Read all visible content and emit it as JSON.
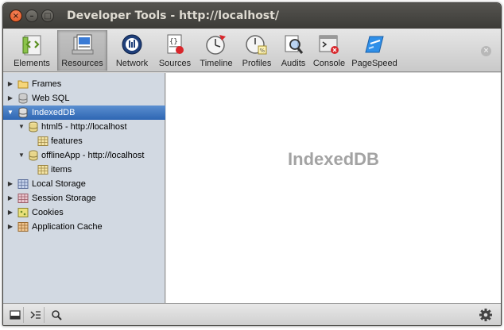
{
  "window": {
    "title": "Developer Tools - http://localhost/",
    "close_glyph": "×",
    "min_glyph": "–",
    "max_glyph": "□"
  },
  "toolbar": {
    "items": [
      {
        "label": "Elements",
        "icon": "elements-icon"
      },
      {
        "label": "Resources",
        "icon": "resources-icon",
        "selected": true
      },
      {
        "label": "Network",
        "icon": "network-icon"
      },
      {
        "label": "Sources",
        "icon": "sources-icon"
      },
      {
        "label": "Timeline",
        "icon": "timeline-icon"
      },
      {
        "label": "Profiles",
        "icon": "profiles-icon"
      },
      {
        "label": "Audits",
        "icon": "audits-icon"
      },
      {
        "label": "Console",
        "icon": "console-icon"
      },
      {
        "label": "PageSpeed",
        "icon": "pagespeed-icon"
      }
    ],
    "close_glyph": "×"
  },
  "sidebar": {
    "items": [
      {
        "label": "Frames",
        "expanded": false
      },
      {
        "label": "Web SQL",
        "expanded": false
      },
      {
        "label": "IndexedDB",
        "expanded": true,
        "selected": true
      },
      {
        "label": "html5 - http://localhost",
        "expanded": true
      },
      {
        "label": "features"
      },
      {
        "label": "offlineApp - http://localhost",
        "expanded": true
      },
      {
        "label": "items"
      },
      {
        "label": "Local Storage",
        "expanded": false
      },
      {
        "label": "Session Storage",
        "expanded": false
      },
      {
        "label": "Cookies",
        "expanded": false
      },
      {
        "label": "Application Cache",
        "expanded": false
      }
    ],
    "collapsed_glyph": "▶",
    "expanded_glyph": "▼"
  },
  "main": {
    "placeholder": "IndexedDB"
  },
  "statusbar": {
    "icons": [
      "dock-icon",
      "console-drawer-icon",
      "search-icon",
      "gear-icon"
    ]
  },
  "colors": {
    "titlebar": "#3c3b37",
    "selection": "#3874c3",
    "sidebar_bg": "#d2d9e2"
  }
}
